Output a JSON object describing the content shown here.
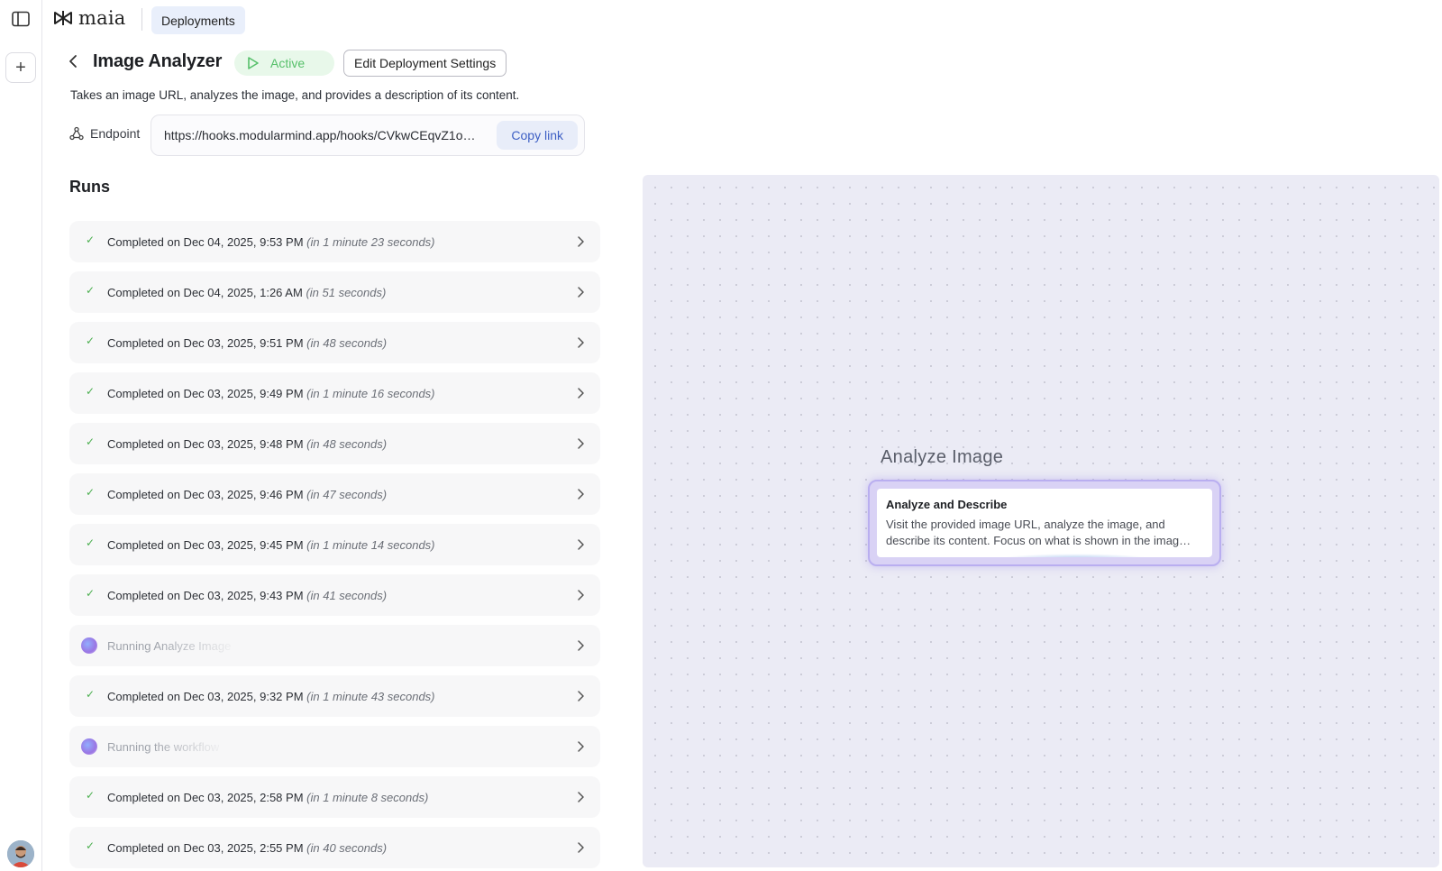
{
  "app": {
    "name": "maia"
  },
  "breadcrumb": {
    "current": "Deployments"
  },
  "header": {
    "title": "Image Analyzer",
    "status": "Active",
    "edit_label": "Edit Deployment Settings",
    "description": "Takes an image URL, analyzes the image, and provides a description of its content."
  },
  "endpoint": {
    "label": "Endpoint",
    "url": "https://hooks.modularmind.app/hooks/CVkwCEqvZ1o…",
    "copy_label": "Copy link"
  },
  "runs": {
    "title": "Runs",
    "items": [
      {
        "status": "completed",
        "text": "Completed on Dec 04, 2025, 9:53 PM",
        "duration": "(in 1 minute 23 seconds)"
      },
      {
        "status": "completed",
        "text": "Completed on Dec 04, 2025, 1:26 AM",
        "duration": "(in 51 seconds)"
      },
      {
        "status": "completed",
        "text": "Completed on Dec 03, 2025, 9:51 PM",
        "duration": "(in 48 seconds)"
      },
      {
        "status": "completed",
        "text": "Completed on Dec 03, 2025, 9:49 PM",
        "duration": "(in 1 minute 16 seconds)"
      },
      {
        "status": "completed",
        "text": "Completed on Dec 03, 2025, 9:48 PM",
        "duration": "(in 48 seconds)"
      },
      {
        "status": "completed",
        "text": "Completed on Dec 03, 2025, 9:46 PM",
        "duration": "(in 47 seconds)"
      },
      {
        "status": "completed",
        "text": "Completed on Dec 03, 2025, 9:45 PM",
        "duration": "(in 1 minute 14 seconds)"
      },
      {
        "status": "completed",
        "text": "Completed on Dec 03, 2025, 9:43 PM",
        "duration": "(in 41 seconds)"
      },
      {
        "status": "running",
        "text": "Running Analyze Image",
        "duration": ""
      },
      {
        "status": "completed",
        "text": "Completed on Dec 03, 2025, 9:32 PM",
        "duration": "(in 1 minute 43 seconds)"
      },
      {
        "status": "running",
        "text": "Running the workflow",
        "duration": ""
      },
      {
        "status": "completed",
        "text": "Completed on Dec 03, 2025, 2:58 PM",
        "duration": "(in 1 minute 8 seconds)"
      },
      {
        "status": "completed",
        "text": "Completed on Dec 03, 2025, 2:55 PM",
        "duration": "(in 40 seconds)"
      }
    ]
  },
  "canvas": {
    "group_label": "Analyze Image",
    "node": {
      "title": "Analyze and Describe",
      "text": "Visit the provided image URL, analyze the image, and describe its content. Focus on what is shown in the imag…"
    }
  },
  "icons": {
    "sidebar_toggle": "sidebar-toggle-icon",
    "new": "plus-icon",
    "back": "chevron-left-icon",
    "play": "play-icon",
    "endpoint": "webhook-icon",
    "check": "check-icon",
    "chevron": "chevron-right-icon"
  },
  "colors": {
    "accent": "#3d5fc4",
    "active_green": "#56c06a",
    "canvas_bg": "#ebebf5",
    "node_border": "#b9aef0"
  }
}
